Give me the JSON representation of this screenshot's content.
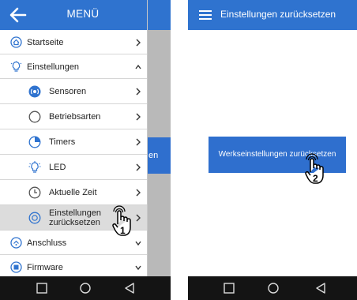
{
  "screen1": {
    "header": {
      "title": "MENÜ",
      "back_icon": "arrow-left-icon"
    },
    "background_button_fragment": "en",
    "menu": [
      {
        "label": "Startseite",
        "icon": "home-icon",
        "chevron": "right",
        "level": 0
      },
      {
        "label": "Einstellungen",
        "icon": "settings-bulb-icon",
        "chevron": "up",
        "level": 0
      },
      {
        "label": "Sensoren",
        "icon": "sensor-icon",
        "chevron": "right",
        "level": 1
      },
      {
        "label": "Betriebsarten",
        "icon": "circle-icon",
        "chevron": "right",
        "level": 1
      },
      {
        "label": "Timers",
        "icon": "timer-icon",
        "chevron": "right",
        "level": 1
      },
      {
        "label": "LED",
        "icon": "led-bulb-icon",
        "chevron": "right",
        "level": 1
      },
      {
        "label": "Aktuelle Zeit",
        "icon": "clock-icon",
        "chevron": "right",
        "level": 1
      },
      {
        "label_line1": "Einstellungen",
        "label_line2": "zurücksetzen",
        "icon": "reset-icon",
        "chevron": "right",
        "level": 1,
        "selected": true
      },
      {
        "label": "Anschluss",
        "icon": "connection-icon",
        "chevron": "down",
        "level": 0
      },
      {
        "label": "Firmware",
        "icon": "firmware-icon",
        "chevron": "down",
        "level": 0
      }
    ],
    "step_number": "1"
  },
  "screen2": {
    "header": {
      "title": "Einstellungen zurücksetzen",
      "menu_icon": "hamburger-icon"
    },
    "reset_button_label": "Werkseinstellungen zurücksetzen",
    "step_number": "2"
  },
  "navbar": {
    "icons": [
      "square-icon",
      "circle-icon",
      "triangle-back-icon"
    ]
  },
  "colors": {
    "accent": "#2f73cf",
    "navbar": "#141414",
    "selected_row": "#dcdcdc",
    "icon_blue": "#2f73cf"
  }
}
